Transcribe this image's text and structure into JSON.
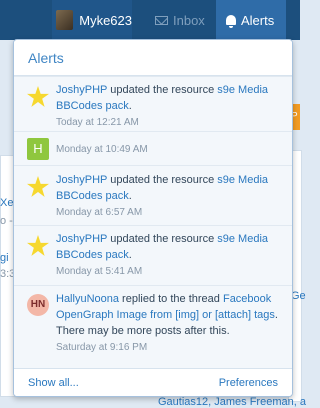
{
  "nav": {
    "username": "Myke623",
    "inbox_label": "Inbox",
    "alerts_label": "Alerts"
  },
  "popup": {
    "title": "Alerts",
    "alerts": [
      {
        "icon": "star-icon",
        "user": "JoshyPHP",
        "action": "updated the resource",
        "target": "s9e Media BBCodes pack",
        "suffix": ".",
        "time": "Today at 12:21 AM"
      },
      {
        "icon": "h-avatar",
        "avatar_letter": "H",
        "user": "",
        "action": "",
        "target": "",
        "suffix": "",
        "time": "Monday at 10:49 AM"
      },
      {
        "icon": "star-icon",
        "user": "JoshyPHP",
        "action": "updated the resource",
        "target": "s9e Media BBCodes pack",
        "suffix": ".",
        "time": "Monday at 6:57 AM"
      },
      {
        "icon": "star-icon",
        "user": "JoshyPHP",
        "action": "updated the resource",
        "target": "s9e Media BBCodes pack",
        "suffix": ".",
        "time": "Monday at 5:41 AM"
      },
      {
        "icon": "hn-avatar",
        "avatar_letter": "HN",
        "user": "HallyuNoona",
        "action": "replied to the thread",
        "target": "Facebook OpenGraph Image from [img] or [attach] tags",
        "suffix": ". There may be more posts after this.",
        "time": "Saturday at 9:16 PM"
      }
    ],
    "show_all": "Show all...",
    "preferences": "Preferences"
  },
  "background": {
    "fragments": [
      "Xer",
      "o -",
      "gi",
      "3:3",
      "Ge",
      "Gautias12, James Freeman, a",
      "P"
    ]
  },
  "colors": {
    "topbar": "#1c4f7d",
    "accent": "#3f85c4",
    "link": "#2a78bf",
    "orange": "#f39c23"
  }
}
